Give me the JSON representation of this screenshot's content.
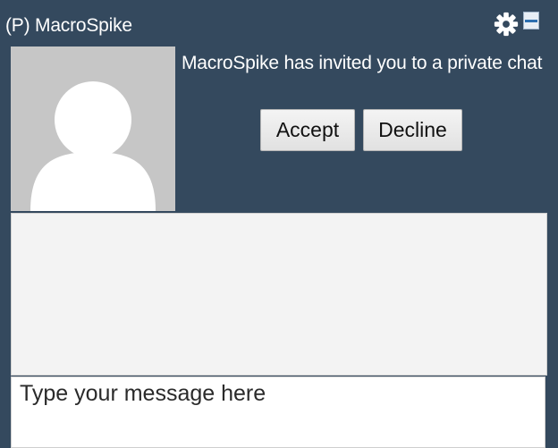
{
  "window": {
    "title": "(P) MacroSpike"
  },
  "header_icons": {
    "settings": "gear-icon",
    "minimize": "minimize-icon"
  },
  "invitation": {
    "text": "MacroSpike has invited you to a private chat",
    "accept_label": "Accept",
    "decline_label": "Decline"
  },
  "composer": {
    "placeholder": "Type your message here"
  },
  "colors": {
    "background": "#34495e",
    "avatar_bg": "#c6c6c6",
    "avatar_fg": "#ffffff"
  }
}
